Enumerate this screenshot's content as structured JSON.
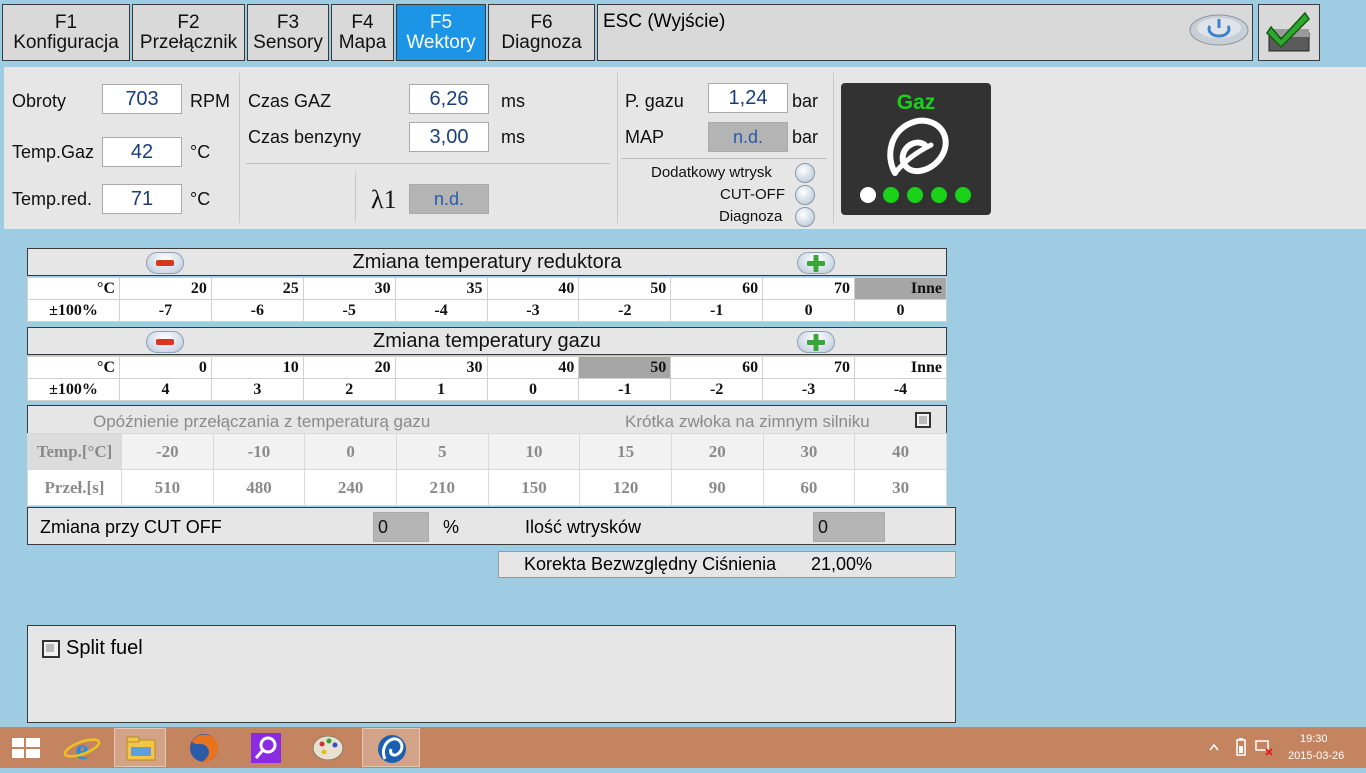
{
  "tabs": [
    {
      "key": "F1",
      "label": "Konfiguracja"
    },
    {
      "key": "F2",
      "label": "Przełącznik"
    },
    {
      "key": "F3",
      "label": "Sensory"
    },
    {
      "key": "F4",
      "label": "Mapa"
    },
    {
      "key": "F5",
      "label": "Wektory"
    },
    {
      "key": "F6",
      "label": "Diagnoza"
    }
  ],
  "active_tab": "F5",
  "esc_label": "ESC (Wyjście)",
  "sensors": {
    "obroty": {
      "label": "Obroty",
      "value": "703",
      "unit": "RPM"
    },
    "temp_gaz": {
      "label": "Temp.Gaz",
      "value": "42",
      "unit": "°C"
    },
    "temp_red": {
      "label": "Temp.red.",
      "value": "71",
      "unit": "°C"
    },
    "czas_gaz": {
      "label": "Czas GAZ",
      "value": "6,26",
      "unit": "ms"
    },
    "czas_benzyny": {
      "label": "Czas benzyny",
      "value": "3,00",
      "unit": "ms"
    },
    "lambda": {
      "label": "λ1",
      "value": "n.d."
    },
    "p_gazu": {
      "label": "P. gazu",
      "value": "1,24",
      "unit": "bar"
    },
    "map": {
      "label": "MAP",
      "value": "n.d.",
      "unit": "bar"
    },
    "indicators": [
      "Dodatkowy wtrysk",
      "CUT-OFF",
      "Diagnoza"
    ],
    "fuel_status": "Gaz",
    "fuel_dots": [
      "white",
      "green",
      "green",
      "green",
      "green"
    ]
  },
  "reducer_table": {
    "title": "Zmiana temperatury reduktora",
    "row1_label": "°C",
    "row2_label": "±100%",
    "temps": [
      "20",
      "25",
      "30",
      "35",
      "40",
      "50",
      "60",
      "70",
      "Inne"
    ],
    "values": [
      "-7",
      "-6",
      "-5",
      "-4",
      "-3",
      "-2",
      "-1",
      "0",
      "0"
    ],
    "highlight_index": 8
  },
  "gas_table": {
    "title": "Zmiana temperatury gazu",
    "row1_label": "°C",
    "row2_label": "±100%",
    "temps": [
      "0",
      "10",
      "20",
      "30",
      "40",
      "50",
      "60",
      "70",
      "Inne"
    ],
    "values": [
      "4",
      "3",
      "2",
      "1",
      "0",
      "-1",
      "-2",
      "-3",
      "-4"
    ],
    "highlight_index": 5
  },
  "delay_table": {
    "title": "Opóźnienie przełączania z temperaturą gazu",
    "short_delay_label": "Krótka zwłoka na zimnym silniku",
    "row1_label": "Temp.[°C]",
    "row2_label": "Przeł.[s]",
    "temps": [
      "-20",
      "-10",
      "0",
      "5",
      "10",
      "15",
      "20",
      "30",
      "40"
    ],
    "values": [
      "510",
      "480",
      "240",
      "210",
      "150",
      "120",
      "90",
      "60",
      "30"
    ]
  },
  "cutoff": {
    "label": "Zmiana przy CUT OFF",
    "value": "0",
    "unit": "%",
    "injections_label": "Ilość wtrysków",
    "injections_value": "0"
  },
  "pressure_correction": {
    "label": "Korekta Bezwzględny Ciśnienia",
    "value": "21,00%"
  },
  "split_fuel_label": "Split fuel",
  "taskbar": {
    "time": "19:30",
    "date": "2015-03-26"
  },
  "colors": {
    "active_tab": "#1d95e6",
    "background": "#9ecce2",
    "panel": "#e6e6e6",
    "gas_green": "#19d219"
  }
}
